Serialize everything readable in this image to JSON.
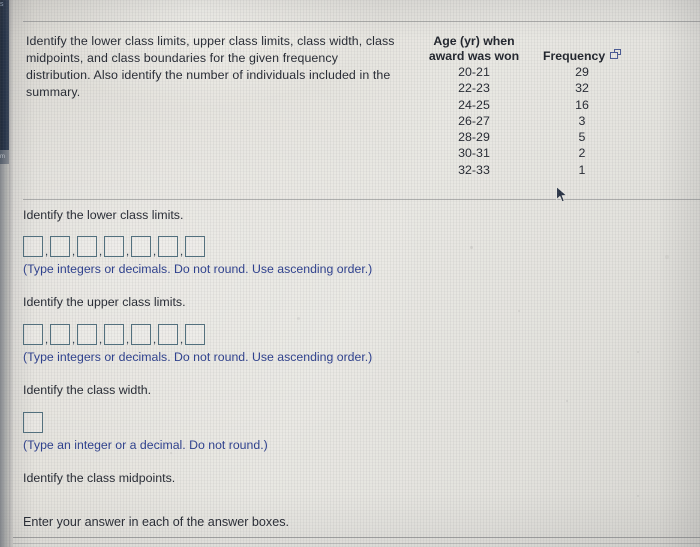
{
  "window": {
    "edge_strip_label": "s",
    "edge_tab_label": "m"
  },
  "question": {
    "stem": "Identify the lower class limits, upper class limits, class width, class midpoints, and class boundaries for the given frequency distribution. Also identify the number of individuals included in the summary."
  },
  "table": {
    "header_col1_line1": "Age (yr) when",
    "header_col1_line2": "award was won",
    "header_col2": "Frequency",
    "copy_icon": "copy-icon",
    "rows": [
      {
        "age": "20-21",
        "frequency": "29"
      },
      {
        "age": "22-23",
        "frequency": "32"
      },
      {
        "age": "24-25",
        "frequency": "16"
      },
      {
        "age": "26-27",
        "frequency": "3"
      },
      {
        "age": "28-29",
        "frequency": "5"
      },
      {
        "age": "30-31",
        "frequency": "2"
      },
      {
        "age": "32-33",
        "frequency": "1"
      }
    ]
  },
  "answers": {
    "lower_limits": {
      "prompt": "Identify the lower class limits.",
      "box_count": 7,
      "separator": ",",
      "hint": "(Type integers or decimals. Do not round. Use ascending order.)"
    },
    "upper_limits": {
      "prompt": "Identify the upper class limits.",
      "box_count": 7,
      "separator": ",",
      "hint": "(Type integers or decimals. Do not round. Use ascending order.)"
    },
    "class_width": {
      "prompt": "Identify the class width.",
      "box_count": 1,
      "hint": "(Type an integer or a decimal. Do not round.)"
    },
    "class_midpoints": {
      "prompt": "Identify the class midpoints."
    }
  },
  "footer": {
    "note": "Enter your answer in each of the answer boxes."
  },
  "cursor": {
    "icon": "mouse-pointer-icon"
  },
  "colors": {
    "hint_blue": "#2c3f8e",
    "box_border": "#51707e",
    "text": "#262a33",
    "icon_blue": "#4a5a93",
    "page_bg": "#e6e4df"
  }
}
